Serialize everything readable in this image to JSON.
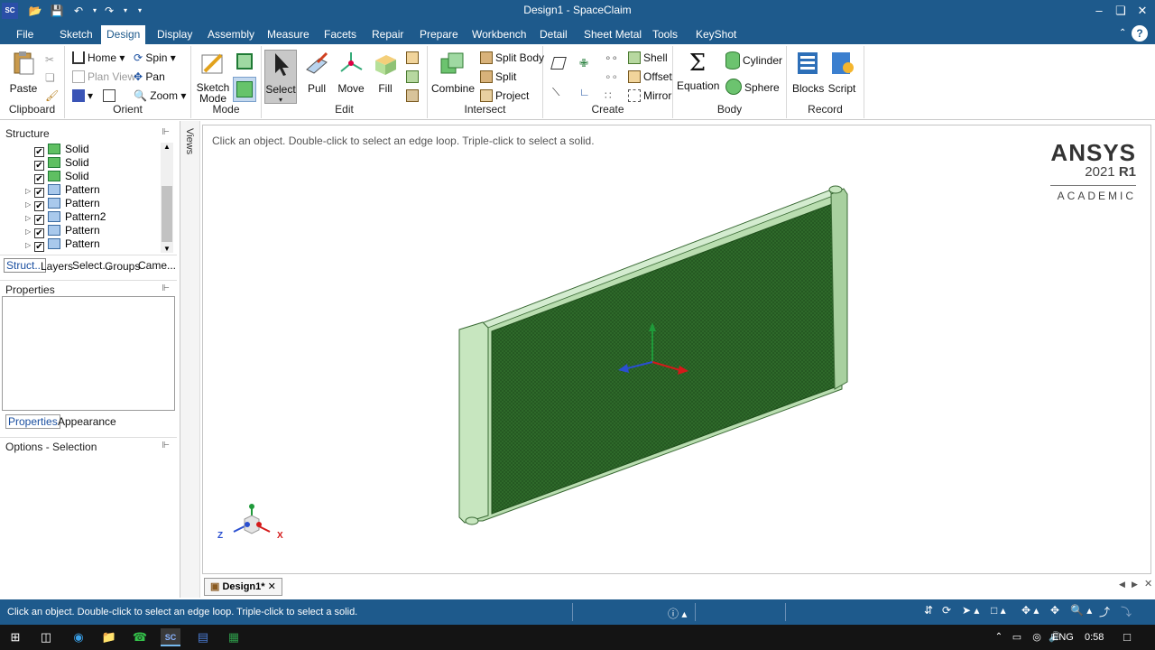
{
  "app": {
    "title": "Design1 - SpaceClaim",
    "logo": "SC"
  },
  "menu": {
    "tabs": [
      "File",
      "Sketch",
      "Design",
      "Display",
      "Assembly",
      "Measure",
      "Facets",
      "Repair",
      "Prepare",
      "Workbench",
      "Detail",
      "Sheet Metal",
      "Tools",
      "KeyShot"
    ],
    "active": "Design"
  },
  "ribbon": {
    "clipboard": {
      "label": "Clipboard",
      "paste": "Paste"
    },
    "orient": {
      "label": "Orient",
      "home": "Home",
      "spin": "Spin",
      "plan_view": "Plan View",
      "pan": "Pan",
      "zoom": "Zoom"
    },
    "mode": {
      "label": "Mode",
      "sketch_mode": "Sketch Mode"
    },
    "edit": {
      "label": "Edit",
      "select": "Select",
      "pull": "Pull",
      "move": "Move",
      "fill": "Fill"
    },
    "intersect": {
      "label": "Intersect",
      "combine": "Combine",
      "split_body": "Split Body",
      "split": "Split",
      "project": "Project"
    },
    "create": {
      "label": "Create",
      "shell": "Shell",
      "offset": "Offset",
      "mirror": "Mirror"
    },
    "body": {
      "label": "Body",
      "equation": "Equation",
      "cylinder": "Cylinder",
      "sphere": "Sphere"
    },
    "record": {
      "label": "Record",
      "blocks": "Blocks",
      "script": "Script"
    }
  },
  "structure": {
    "title": "Structure",
    "items": [
      {
        "label": "Solid",
        "expandable": false,
        "icon": "solid-icon"
      },
      {
        "label": "Solid",
        "expandable": false,
        "icon": "solid-icon"
      },
      {
        "label": "Solid",
        "expandable": false,
        "icon": "solid-icon"
      },
      {
        "label": "Pattern",
        "expandable": true,
        "icon": "pattern-icon"
      },
      {
        "label": "Pattern",
        "expandable": true,
        "icon": "pattern-icon"
      },
      {
        "label": "Pattern2",
        "expandable": true,
        "icon": "pattern-icon"
      },
      {
        "label": "Pattern",
        "expandable": true,
        "icon": "pattern-icon"
      },
      {
        "label": "Pattern",
        "expandable": true,
        "icon": "pattern-icon"
      }
    ],
    "tabs": [
      "Struct...",
      "Layers",
      "Select...",
      "Groups",
      "Came..."
    ]
  },
  "properties": {
    "title": "Properties",
    "tabs": [
      "Properties",
      "Appearance"
    ]
  },
  "options": {
    "title": "Options - Selection"
  },
  "views_label": "Views",
  "viewport": {
    "hint": "Click an object. Double-click to select an edge loop. Triple-click to select a solid.",
    "brand": {
      "name": "ANSYS",
      "version": "2021",
      "release": "R1",
      "edition": "ACADEMIC"
    },
    "triad": {
      "x": "X",
      "z": "Z"
    }
  },
  "doc_tab": {
    "label": "Design1*"
  },
  "status": {
    "message": "Click an object. Double-click to select an edge loop. Triple-click to select a solid."
  },
  "taskbar": {
    "lang": "ENG",
    "time": "0:58"
  },
  "colors": {
    "brand_blue": "#1e5a8c",
    "radiator_core": "#2e6b2a",
    "radiator_frame": "#b9ddb0"
  }
}
